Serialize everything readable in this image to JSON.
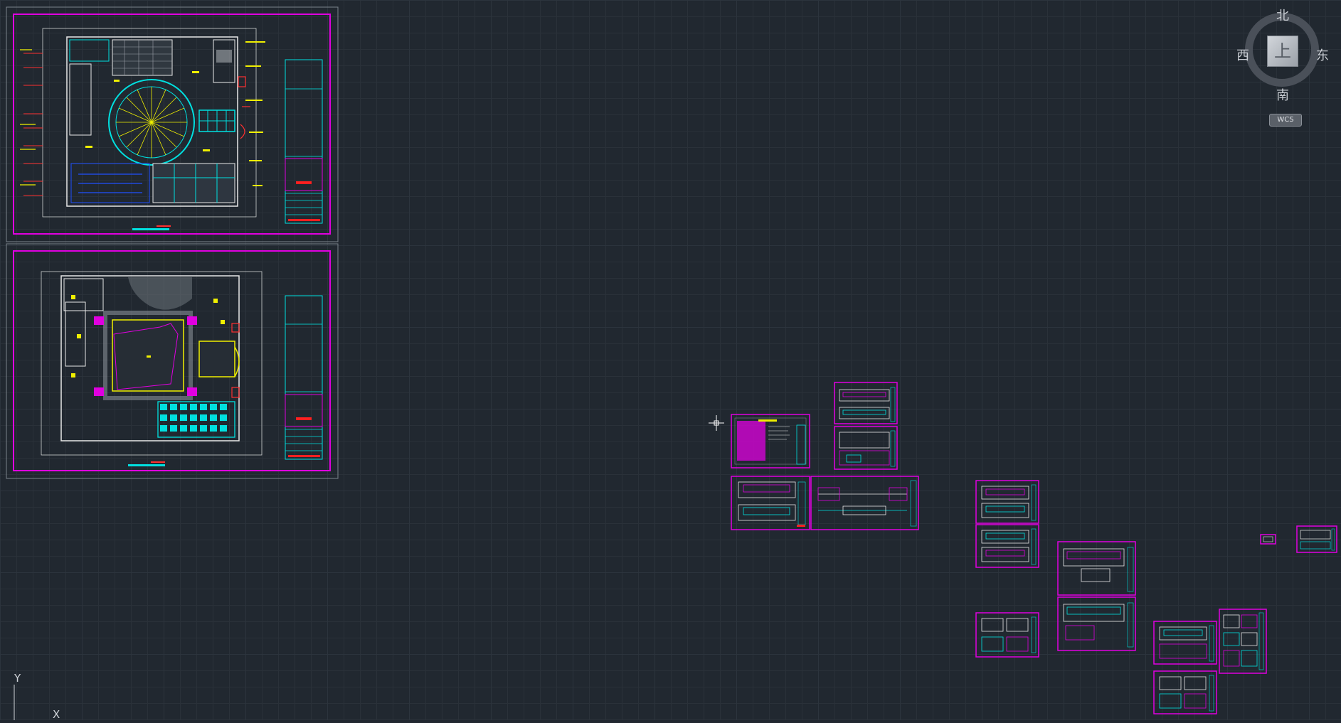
{
  "viewcube": {
    "north": "北",
    "south": "南",
    "west": "西",
    "east": "东",
    "face": "上",
    "coord_system": "WCS"
  },
  "ucs": {
    "x_label": "X",
    "y_label": "Y"
  },
  "colors": {
    "background": "#212830",
    "sheet_border": "#e000e0",
    "cyan": "#00e0e0",
    "yellow": "#f0f000",
    "white": "#e8e8e8",
    "red": "#ff2020",
    "blue": "#2050ff"
  },
  "icons": {
    "cursor": "crosshair-cursor-icon",
    "compass": "compass-ring-icon"
  }
}
